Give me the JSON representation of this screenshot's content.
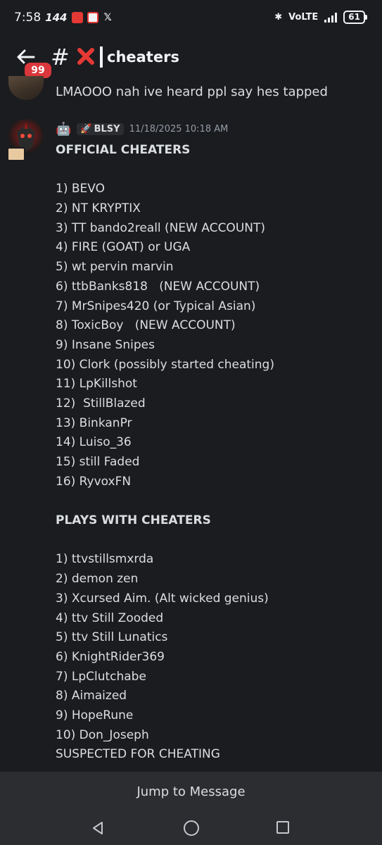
{
  "status_bar": {
    "time": "7:58",
    "refresh": "144",
    "network": "VoLTE",
    "battery": "61"
  },
  "header": {
    "unread_badge": "99",
    "hash": "#",
    "channel_name": "cheaters"
  },
  "previous_message": {
    "text": "LMAOOO nah ive heard ppl say hes tapped"
  },
  "message": {
    "robot_emoji": "🤖",
    "tag_label": "BLSY",
    "timestamp": "11/18/2025 10:18 AM",
    "lines": [
      {
        "text": "OFFICIAL CHEATERS",
        "bold": true
      },
      {
        "text": "",
        "bold": false
      },
      {
        "text": "1) BEVO",
        "bold": false
      },
      {
        "text": "2) NT KRYPTIX",
        "bold": false
      },
      {
        "text": "3) TT bando2reall (NEW ACCOUNT)",
        "bold": false
      },
      {
        "text": "4) FIRE (GOAT) or UGA",
        "bold": false
      },
      {
        "text": "5) wt pervin marvin",
        "bold": false
      },
      {
        "text": "6) ttbBanks818   (NEW ACCOUNT)",
        "bold": false
      },
      {
        "text": "7) MrSnipes420 (or Typical Asian)",
        "bold": false
      },
      {
        "text": "8) ToxicBoy   (NEW ACCOUNT)",
        "bold": false
      },
      {
        "text": "9) Insane Snipes",
        "bold": false
      },
      {
        "text": "10) Clork (possibly started cheating)",
        "bold": false
      },
      {
        "text": "11) LpKillshot",
        "bold": false
      },
      {
        "text": "12)  StillBlazed",
        "bold": false
      },
      {
        "text": "13) BinkanPr",
        "bold": false
      },
      {
        "text": "14) Luiso_36",
        "bold": false
      },
      {
        "text": "15) still Faded",
        "bold": false
      },
      {
        "text": "16) RyvoxFN",
        "bold": false
      },
      {
        "text": "",
        "bold": false
      },
      {
        "text": "PLAYS WITH CHEATERS",
        "bold": true
      },
      {
        "text": "",
        "bold": false
      },
      {
        "text": "1) ttvstillsmxrda",
        "bold": false
      },
      {
        "text": "2) demon zen",
        "bold": false
      },
      {
        "text": "3) Xcursed Aim. (Alt wicked genius)",
        "bold": false
      },
      {
        "text": "4) ttv Still Zooded",
        "bold": false
      },
      {
        "text": "5) ttv Still Lunatics",
        "bold": false
      },
      {
        "text": "6) KnightRider369",
        "bold": false
      },
      {
        "text": "7) LpClutchabe",
        "bold": false
      },
      {
        "text": "8) Aimaized",
        "bold": false
      },
      {
        "text": "9) HopeRune",
        "bold": false
      },
      {
        "text": "10) Don_Joseph",
        "bold": false
      },
      {
        "text": "SUSPECTED FOR CHEATING",
        "bold": false
      }
    ]
  },
  "jump_button": {
    "label": "Jump to Message"
  },
  "colors": {
    "background": "#1b1c20",
    "badge": "#da373c",
    "bar": "#2b2d31"
  }
}
